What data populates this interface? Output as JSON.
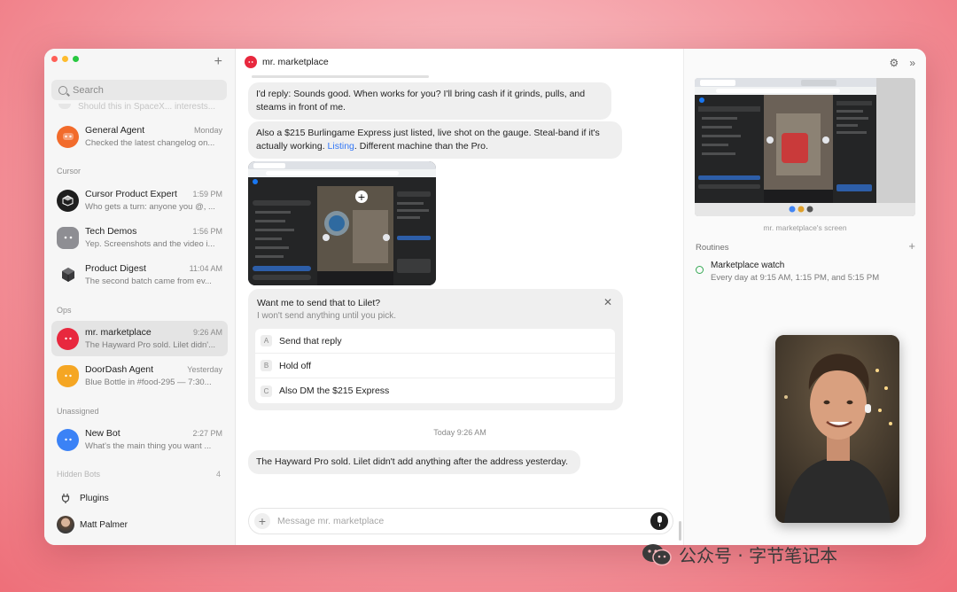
{
  "sidebar": {
    "search_placeholder": "Search",
    "faded_preview": "Should this in SpaceX... interests...",
    "sections": {
      "cursor": "Cursor",
      "ops": "Ops",
      "unassigned": "Unassigned",
      "hidden": "Hidden Bots",
      "hidden_count": "4"
    },
    "chats": [
      {
        "name": "General Agent",
        "time": "Monday",
        "preview": "Checked the latest changelog on...",
        "color": "#f26b2b"
      },
      {
        "name": "Cursor Product Expert",
        "time": "1:59 PM",
        "preview": "Who gets a turn: anyone you @, ...",
        "color": "#1e1e1e"
      },
      {
        "name": "Tech Demos",
        "time": "1:56 PM",
        "preview": "Yep. Screenshots and the video i...",
        "color": "#8e8e93"
      },
      {
        "name": "Product Digest",
        "time": "11:04 AM",
        "preview": "The second batch came from ev...",
        "color": "#2c2c2e"
      },
      {
        "name": "mr. marketplace",
        "time": "9:26 AM",
        "preview": "The Hayward Pro sold. Lilet didn'...",
        "color": "#e8283e"
      },
      {
        "name": "DoorDash Agent",
        "time": "Yesterday",
        "preview": "Blue Bottle in #food-295 — 7:30...",
        "color": "#f5a623"
      },
      {
        "name": "New Bot",
        "time": "2:27 PM",
        "preview": "What's the main thing you want ...",
        "color": "#3b82f6"
      }
    ],
    "plugins_label": "Plugins",
    "user_name": "Matt Palmer"
  },
  "main": {
    "title": "mr. marketplace",
    "msg1": "I'd reply: Sounds good. When works for you? I'll bring cash if it grinds, pulls, and steams in front of me.",
    "msg2_pre": "Also a $215 Burlingame Express just listed, live shot on the gauge. Steal-band if it's actually working. ",
    "msg2_link": "Listing",
    "msg2_post": ". Different machine than the Pro.",
    "card": {
      "title": "Want me to send that to Lilet?",
      "subtitle": "I won't send anything until you pick.",
      "options": [
        {
          "key": "A",
          "label": "Send that reply"
        },
        {
          "key": "B",
          "label": "Hold off"
        },
        {
          "key": "C",
          "label": "Also DM the $215 Express"
        }
      ]
    },
    "timestamp": "Today 9:26 AM",
    "msg3": "The Hayward Pro sold. Lilet didn't add anything after the address yesterday.",
    "composer_placeholder": "Message mr. marketplace"
  },
  "right": {
    "screen_caption": "mr. marketplace's screen",
    "routines_label": "Routines",
    "routine_title": "Marketplace watch",
    "routine_sub": "Every day at 9:15 AM, 1:15 PM, and 5:15 PM"
  },
  "watermark": "公众号 · 字节笔记本"
}
